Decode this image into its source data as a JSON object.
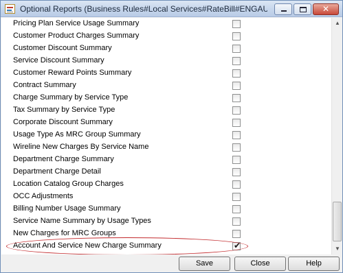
{
  "window": {
    "title": "Optional Reports (Business Rules#Local Services#RateBill#ENGAUT...",
    "icon": "report-icon",
    "controls": {
      "minimize_icon": "minimize-icon",
      "maximize_icon": "maximize-icon",
      "close_glyph": "✕"
    }
  },
  "reports": [
    {
      "label": "Pricing Plan Service Usage Summary",
      "checked": false
    },
    {
      "label": "Customer Product Charges Summary",
      "checked": false
    },
    {
      "label": "Customer Discount Summary",
      "checked": false
    },
    {
      "label": "Service Discount Summary",
      "checked": false
    },
    {
      "label": "Customer Reward Points Summary",
      "checked": false
    },
    {
      "label": "Contract Summary",
      "checked": false
    },
    {
      "label": "Charge Summary by Service Type",
      "checked": false
    },
    {
      "label": "Tax Summary by Service Type",
      "checked": false
    },
    {
      "label": "Corporate Discount Summary",
      "checked": false
    },
    {
      "label": "Usage Type As MRC Group Summary",
      "checked": false
    },
    {
      "label": "Wireline New Charges By Service Name",
      "checked": false
    },
    {
      "label": "Department Charge Summary",
      "checked": false
    },
    {
      "label": "Department Charge Detail",
      "checked": false
    },
    {
      "label": "Location Catalog Group Charges",
      "checked": false
    },
    {
      "label": "OCC Adjustments",
      "checked": false
    },
    {
      "label": "Billing Number Usage Summary",
      "checked": false
    },
    {
      "label": "Service Name Summary by Usage Types",
      "checked": false
    },
    {
      "label": "New Charges for MRC Groups",
      "checked": false
    },
    {
      "label": "Account And Service New Charge Summary",
      "checked": true
    }
  ],
  "check_glyph": "✔",
  "scrollbar": {
    "up_glyph": "▲",
    "down_glyph": "▼"
  },
  "footer": {
    "save_label": "Save",
    "close_label": "Close",
    "help_label": "Help"
  },
  "highlight": {
    "color": "#c2282b",
    "target": "Account And Service New Charge Summary"
  }
}
